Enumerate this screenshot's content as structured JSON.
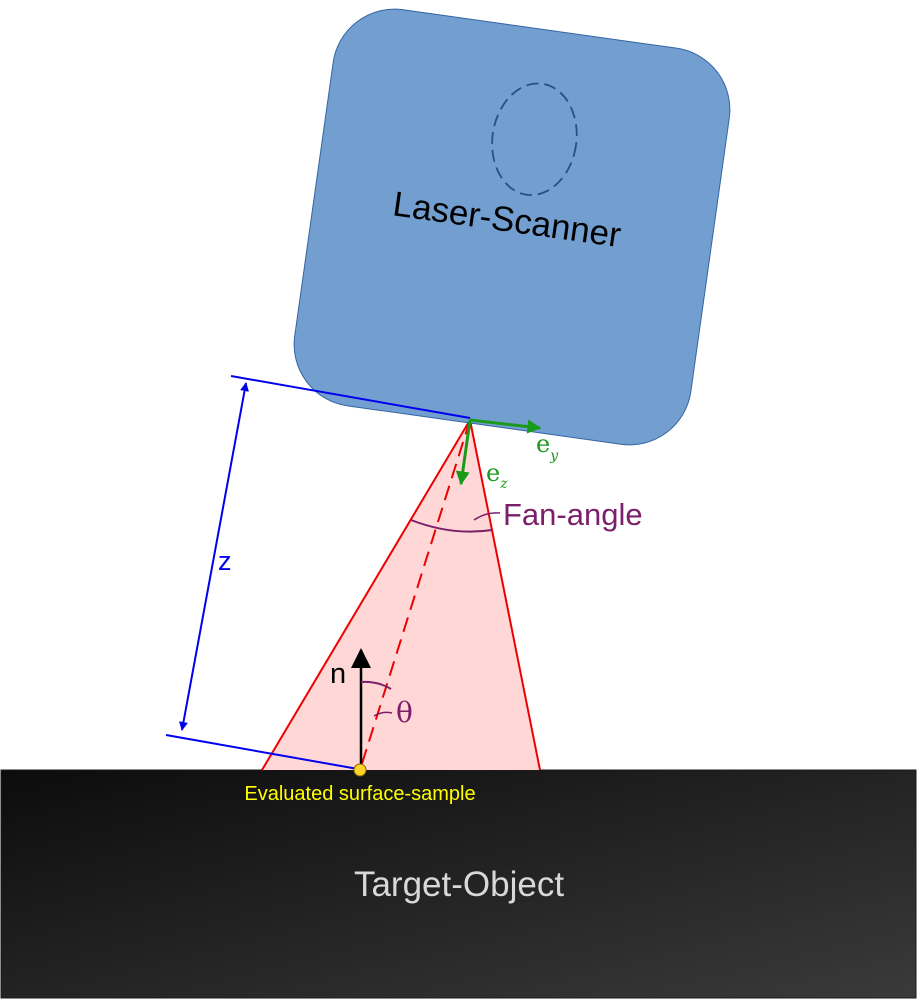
{
  "labels": {
    "scanner": "Laser-Scanner",
    "target": "Target-Object",
    "z": "z",
    "ey_base": "e",
    "ey_sub": "y",
    "ez_base": "e",
    "ez_sub": "z",
    "fan_angle": "Fan-angle",
    "normal": "n",
    "theta": "θ",
    "sample": "Evaluated surface-sample"
  },
  "colors": {
    "scanner_fill": "#729fcf",
    "scanner_stroke": "#3465a4",
    "fan_fill": "#ffd7d7",
    "fan_stroke": "#ee0000",
    "dimension": "#0000ee",
    "axis": "#1a9a1a",
    "angle": "#7b1f6a",
    "sample": "#ffd42a",
    "target_dark": "#0c0c0c",
    "target_light": "#3a3a3a",
    "target_text": "#d8d8d8"
  }
}
